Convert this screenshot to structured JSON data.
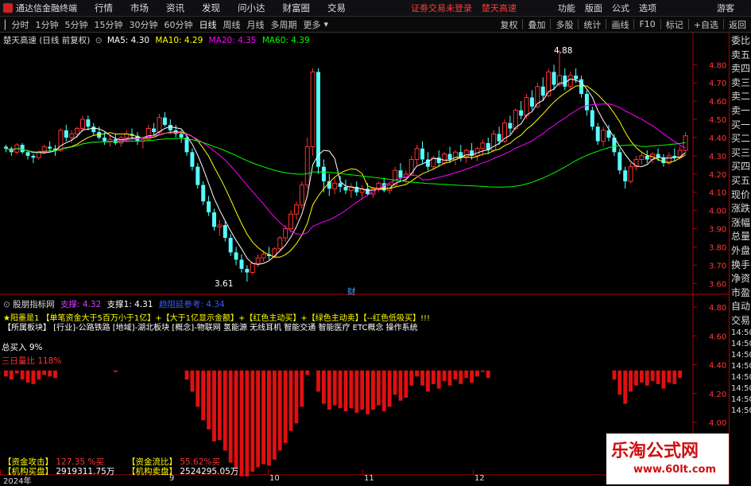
{
  "menubar": {
    "app_name": "通达信金融终端",
    "items": [
      "行情",
      "市场",
      "资讯",
      "发现",
      "问小达",
      "财富圈",
      "交易"
    ],
    "login_text": "证劵交易未登录",
    "stock_name": "楚天高速",
    "right_items": [
      "功能",
      "版面",
      "公式",
      "选项"
    ],
    "guest": "游客",
    "window_controls": [
      "▭",
      "—",
      "□",
      "✕"
    ]
  },
  "toolbar": {
    "items": [
      "分时",
      "1分钟",
      "5分钟",
      "15分钟",
      "30分钟",
      "60分钟",
      "日线",
      "周线",
      "月线",
      "多周期",
      "更多"
    ],
    "active": "日线",
    "right_items": [
      "复权",
      "叠加",
      "多股",
      "统计",
      "画线",
      "F10",
      "标记",
      "+自选",
      "返回"
    ]
  },
  "main_info": {
    "title": "楚天高速 (日线 前复权)",
    "ma5": "MA5: 4.30",
    "ma10": "MA10: 4.29",
    "ma20": "MA20: 4.35",
    "ma60": "MA60: 4.39",
    "high_label": "4.88",
    "low_label": "3.61",
    "fin_label": "财"
  },
  "main_axis": {
    "ticks": [
      "4.80",
      "4.70",
      "4.60",
      "4.50",
      "4.40",
      "4.30",
      "4.20",
      "4.10",
      "4.00",
      "3.90",
      "3.80",
      "3.70",
      "3.60"
    ]
  },
  "lower_info": {
    "name": "股朋指标网",
    "support": "支撑: 4.32",
    "support1": "支撑1: 4.31",
    "resist": "趋阻延参考: 4.34",
    "line1": "★阳墨是1 【单笔资金大于5百万小于1亿】+【大于1亿显示金额】+【红色主动买】+【绿色主动卖】【--红色低吸买】!!!",
    "line2": "【所属板块】 [行业]-公路铁路 [地域]-湖北板块 [概念]-物联网 氢能源 无线耳机 智能交通 智能医疗 ETC概念 操作系统",
    "total_buy": "总买入 9%",
    "three_day": "三日量比 118%",
    "bottom": [
      {
        "label": "【资金攻击】",
        "value": "127.35 %买"
      },
      {
        "label": "【资金流比】",
        "value": "55.62%买"
      },
      {
        "label": "【机构买盘】",
        "value": "2919311.75万"
      },
      {
        "label": "【机构卖盘】",
        "value": "2524295.05万"
      }
    ]
  },
  "lower_axis": {
    "ticks": [
      "4.80",
      "4.60",
      "4.40",
      "4.20",
      "4.00"
    ]
  },
  "right_panel": [
    "委比",
    "卖五",
    "卖四",
    "卖三",
    "卖二",
    "卖一",
    "买一",
    "买二",
    "买三",
    "买四",
    "买五",
    "现价",
    "涨跌",
    "涨幅",
    "总量",
    "外盘",
    "换手",
    "净资",
    "市盈",
    "自动",
    "交易",
    "14:50",
    "14:50",
    "14:50",
    "14:50",
    "14:50",
    "14:50",
    "14:50",
    "14:50"
  ],
  "date_axis": [
    "2024年",
    "9",
    "10",
    "11",
    "12"
  ],
  "watermark": {
    "name": "乐淘公式网",
    "url": "www.60lt.com"
  },
  "chart_data": {
    "type": "candlestick",
    "ylim": [
      3.55,
      4.95
    ],
    "up_color": "#ff3232",
    "down_color": "#54ffff",
    "ma_colors": {
      "ma5": "#ffffff",
      "ma10": "#ffff00",
      "ma20": "#ff00ff",
      "ma60": "#00ff00"
    },
    "candles": [
      [
        4.35,
        4.36,
        4.32,
        4.34
      ],
      [
        4.34,
        4.35,
        4.3,
        4.32
      ],
      [
        4.32,
        4.37,
        4.31,
        4.36
      ],
      [
        4.36,
        4.37,
        4.31,
        4.32
      ],
      [
        4.32,
        4.33,
        4.28,
        4.3
      ],
      [
        4.3,
        4.31,
        4.26,
        4.29
      ],
      [
        4.29,
        4.33,
        4.28,
        4.32
      ],
      [
        4.32,
        4.36,
        4.31,
        4.35
      ],
      [
        4.35,
        4.38,
        4.33,
        4.34
      ],
      [
        4.34,
        4.36,
        4.3,
        4.33
      ],
      [
        4.33,
        4.45,
        4.32,
        4.44
      ],
      [
        4.44,
        4.47,
        4.38,
        4.4
      ],
      [
        4.4,
        4.44,
        4.37,
        4.42
      ],
      [
        4.42,
        4.46,
        4.4,
        4.45
      ],
      [
        4.45,
        4.52,
        4.43,
        4.5
      ],
      [
        4.5,
        4.52,
        4.44,
        4.46
      ],
      [
        4.46,
        4.48,
        4.41,
        4.43
      ],
      [
        4.43,
        4.46,
        4.39,
        4.4
      ],
      [
        4.4,
        4.43,
        4.36,
        4.38
      ],
      [
        4.38,
        4.41,
        4.35,
        4.39
      ],
      [
        4.39,
        4.42,
        4.36,
        4.37
      ],
      [
        4.37,
        4.41,
        4.35,
        4.4
      ],
      [
        4.4,
        4.44,
        4.38,
        4.42
      ],
      [
        4.42,
        4.45,
        4.39,
        4.41
      ],
      [
        4.41,
        4.43,
        4.36,
        4.38
      ],
      [
        4.38,
        4.4,
        4.34,
        4.39
      ],
      [
        4.39,
        4.47,
        4.38,
        4.45
      ],
      [
        4.45,
        4.48,
        4.41,
        4.43
      ],
      [
        4.43,
        4.53,
        4.42,
        4.51
      ],
      [
        4.51,
        4.54,
        4.46,
        4.47
      ],
      [
        4.47,
        4.5,
        4.42,
        4.44
      ],
      [
        4.44,
        4.47,
        4.4,
        4.42
      ],
      [
        4.42,
        4.44,
        4.37,
        4.4
      ],
      [
        4.4,
        4.41,
        4.3,
        4.32
      ],
      [
        4.32,
        4.34,
        4.22,
        4.24
      ],
      [
        4.24,
        4.26,
        4.12,
        4.14
      ],
      [
        4.14,
        4.16,
        4.03,
        4.05
      ],
      [
        4.05,
        4.08,
        3.97,
        3.99
      ],
      [
        3.99,
        4.01,
        3.89,
        3.91
      ],
      [
        3.91,
        3.95,
        3.86,
        3.92
      ],
      [
        3.92,
        3.94,
        3.83,
        3.85
      ],
      [
        3.85,
        3.87,
        3.75,
        3.77
      ],
      [
        3.77,
        3.8,
        3.7,
        3.73
      ],
      [
        3.73,
        3.76,
        3.66,
        3.68
      ],
      [
        3.68,
        3.7,
        3.61,
        3.66
      ],
      [
        3.66,
        3.72,
        3.65,
        3.71
      ],
      [
        3.71,
        3.76,
        3.69,
        3.74
      ],
      [
        3.74,
        3.78,
        3.72,
        3.76
      ],
      [
        3.76,
        3.8,
        3.73,
        3.75
      ],
      [
        3.75,
        3.8,
        3.74,
        3.79
      ],
      [
        3.79,
        3.86,
        3.78,
        3.85
      ],
      [
        3.85,
        3.92,
        3.83,
        3.9
      ],
      [
        3.9,
        4.0,
        3.88,
        3.98
      ],
      [
        3.98,
        4.05,
        3.95,
        4.03
      ],
      [
        4.03,
        4.16,
        4.01,
        4.14
      ],
      [
        4.14,
        4.4,
        4.12,
        4.35
      ],
      [
        4.35,
        4.78,
        4.3,
        4.76
      ],
      [
        4.76,
        4.78,
        4.2,
        4.24
      ],
      [
        4.24,
        4.28,
        4.1,
        4.16
      ],
      [
        4.16,
        4.2,
        4.08,
        4.12
      ],
      [
        4.12,
        4.18,
        4.09,
        4.15
      ],
      [
        4.15,
        4.19,
        4.1,
        4.13
      ],
      [
        4.13,
        4.17,
        4.09,
        4.11
      ],
      [
        4.11,
        4.15,
        4.07,
        4.13
      ],
      [
        4.13,
        4.16,
        4.08,
        4.1
      ],
      [
        4.1,
        4.14,
        4.06,
        4.12
      ],
      [
        4.12,
        4.15,
        4.08,
        4.09
      ],
      [
        4.09,
        4.13,
        4.07,
        4.12
      ],
      [
        4.12,
        4.16,
        4.1,
        4.15
      ],
      [
        4.15,
        4.18,
        4.1,
        4.11
      ],
      [
        4.11,
        4.15,
        4.09,
        4.14
      ],
      [
        4.14,
        4.24,
        4.13,
        4.22
      ],
      [
        4.22,
        4.26,
        4.16,
        4.18
      ],
      [
        4.18,
        4.22,
        4.15,
        4.2
      ],
      [
        4.2,
        4.3,
        4.19,
        4.28
      ],
      [
        4.28,
        4.36,
        4.25,
        4.34
      ],
      [
        4.34,
        4.38,
        4.26,
        4.28
      ],
      [
        4.28,
        4.32,
        4.22,
        4.24
      ],
      [
        4.24,
        4.3,
        4.22,
        4.29
      ],
      [
        4.29,
        4.33,
        4.24,
        4.26
      ],
      [
        4.26,
        4.32,
        4.25,
        4.31
      ],
      [
        4.31,
        4.35,
        4.26,
        4.28
      ],
      [
        4.28,
        4.33,
        4.25,
        4.32
      ],
      [
        4.32,
        4.36,
        4.27,
        4.29
      ],
      [
        4.29,
        4.34,
        4.26,
        4.33
      ],
      [
        4.33,
        4.37,
        4.28,
        4.3
      ],
      [
        4.3,
        4.35,
        4.27,
        4.34
      ],
      [
        4.34,
        4.39,
        4.3,
        4.37
      ],
      [
        4.37,
        4.4,
        4.31,
        4.33
      ],
      [
        4.33,
        4.44,
        4.32,
        4.42
      ],
      [
        4.42,
        4.46,
        4.36,
        4.38
      ],
      [
        4.38,
        4.5,
        4.37,
        4.48
      ],
      [
        4.48,
        4.52,
        4.42,
        4.45
      ],
      [
        4.45,
        4.56,
        4.44,
        4.55
      ],
      [
        4.55,
        4.6,
        4.5,
        4.52
      ],
      [
        4.52,
        4.64,
        4.5,
        4.62
      ],
      [
        4.62,
        4.66,
        4.55,
        4.57
      ],
      [
        4.57,
        4.7,
        4.56,
        4.68
      ],
      [
        4.68,
        4.73,
        4.6,
        4.63
      ],
      [
        4.63,
        4.78,
        4.62,
        4.76
      ],
      [
        4.76,
        4.8,
        4.66,
        4.69
      ],
      [
        4.69,
        4.88,
        4.68,
        4.74
      ],
      [
        4.74,
        4.78,
        4.66,
        4.68
      ],
      [
        4.68,
        4.76,
        4.66,
        4.74
      ],
      [
        4.74,
        4.78,
        4.7,
        4.72
      ],
      [
        4.72,
        4.74,
        4.62,
        4.64
      ],
      [
        4.64,
        4.66,
        4.52,
        4.55
      ],
      [
        4.55,
        4.57,
        4.44,
        4.46
      ],
      [
        4.46,
        4.48,
        4.36,
        4.38
      ],
      [
        4.38,
        4.46,
        4.35,
        4.44
      ],
      [
        4.44,
        4.47,
        4.38,
        4.4
      ],
      [
        4.4,
        4.42,
        4.3,
        4.32
      ],
      [
        4.32,
        4.34,
        4.2,
        4.22
      ],
      [
        4.22,
        4.24,
        4.12,
        4.16
      ],
      [
        4.16,
        4.26,
        4.15,
        4.24
      ],
      [
        4.24,
        4.3,
        4.22,
        4.28
      ],
      [
        4.28,
        4.32,
        4.25,
        4.3
      ],
      [
        4.3,
        4.33,
        4.26,
        4.28
      ],
      [
        4.28,
        4.32,
        4.26,
        4.31
      ],
      [
        4.31,
        4.34,
        4.27,
        4.29
      ],
      [
        4.29,
        4.31,
        4.24,
        4.26
      ],
      [
        4.26,
        4.32,
        4.25,
        4.3
      ],
      [
        4.3,
        4.34,
        4.27,
        4.29
      ],
      [
        4.29,
        4.35,
        4.28,
        4.33
      ],
      [
        4.33,
        4.43,
        4.32,
        4.41
      ]
    ]
  }
}
